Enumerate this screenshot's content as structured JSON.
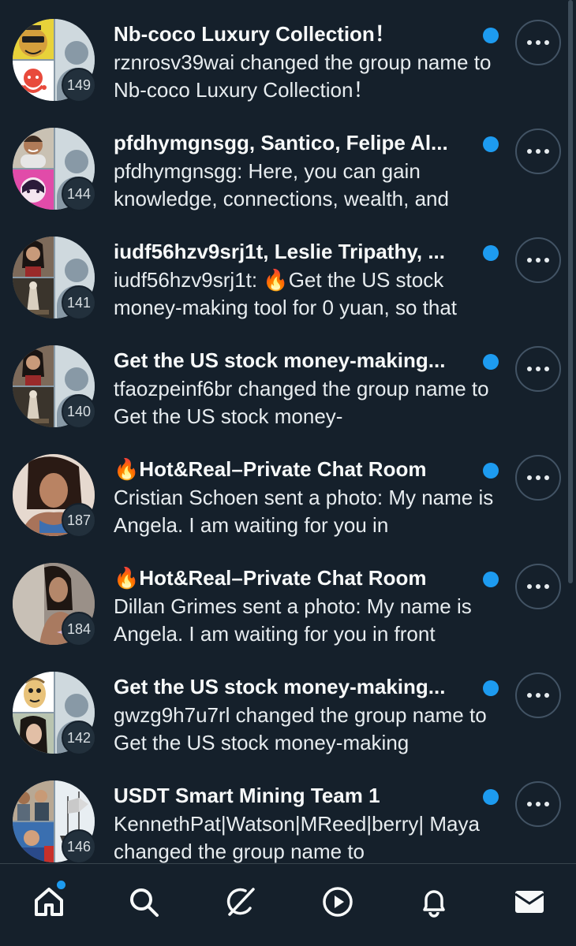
{
  "conversations": [
    {
      "title": "Nb-coco Luxury Collection！",
      "snippet": "rznrosv39wai changed the group name to Nb-coco Luxury Collection！",
      "member_count": "149",
      "unread": true,
      "avatar_style": "group"
    },
    {
      "title": "pfdhymgnsgg, Santico, Felipe Al...",
      "snippet": "pfdhymgnsgg: Here, you can gain knowledge, connections, wealth, and",
      "member_count": "144",
      "unread": true,
      "avatar_style": "group"
    },
    {
      "title": "iudf56hzv9srj1t, Leslie Tripathy, ...",
      "snippet": "iudf56hzv9srj1t: 🔥Get the US stock money-making tool for 0 yuan, so that",
      "member_count": "141",
      "unread": true,
      "avatar_style": "group"
    },
    {
      "title": "Get the US stock money-making...",
      "snippet": "tfaozpeinf6br changed the group name to Get the US stock money-",
      "member_count": "140",
      "unread": true,
      "avatar_style": "group"
    },
    {
      "title": "🔥Hot&Real–Private Chat Room",
      "snippet": "Cristian Schoen sent a photo: My name is Angela. I am waiting for you in",
      "member_count": "187",
      "unread": true,
      "avatar_style": "photo"
    },
    {
      "title": "🔥Hot&Real–Private Chat Room",
      "snippet": "Dillan Grimes sent a photo: My name is Angela. I am waiting for you in front",
      "member_count": "184",
      "unread": true,
      "avatar_style": "photo"
    },
    {
      "title": "Get the US stock money-making...",
      "snippet": "gwzg9h7u7rl changed the group name to Get the US stock money-making",
      "member_count": "142",
      "unread": true,
      "avatar_style": "group"
    },
    {
      "title": "USDT Smart Mining Team 1",
      "snippet": "KennethPat|Watson|MReed|berry| Maya changed the group name to",
      "member_count": "146",
      "unread": true,
      "avatar_style": "group"
    }
  ],
  "tabbar": {
    "items": [
      {
        "icon": "home-icon",
        "active": true,
        "has_notification_dot": true
      },
      {
        "icon": "search-icon",
        "active": false
      },
      {
        "icon": "grok-icon",
        "active": false
      },
      {
        "icon": "video-play-icon",
        "active": false
      },
      {
        "icon": "notifications-bell-icon",
        "active": false
      },
      {
        "icon": "messages-envelope-icon",
        "active": true
      }
    ]
  },
  "colors": {
    "background": "#15202b",
    "accent": "#1d9bf0",
    "text": "#f7f9f9",
    "border": "#38444d"
  }
}
